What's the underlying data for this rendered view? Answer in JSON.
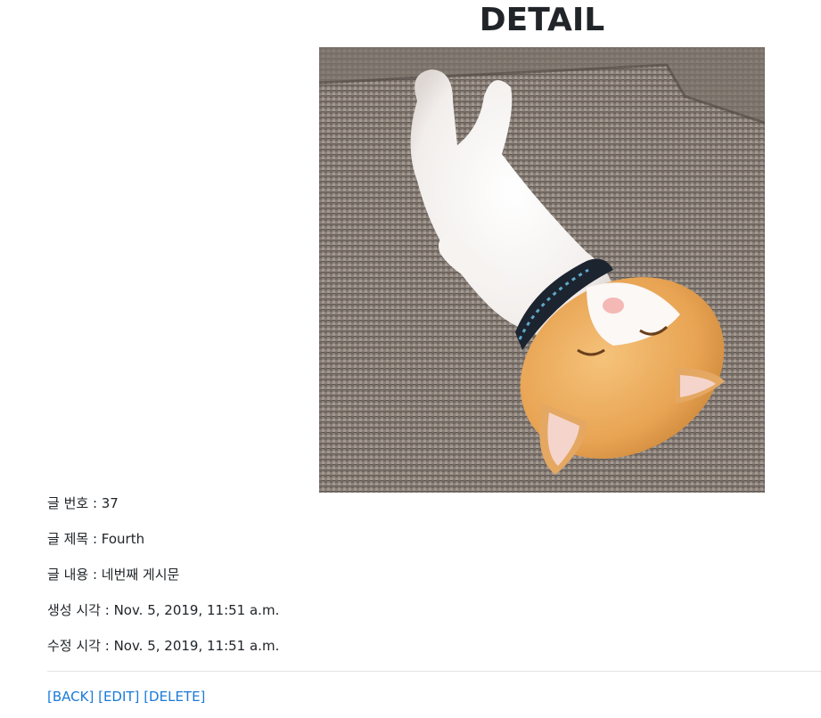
{
  "header": {
    "title": "DETAIL"
  },
  "image": {
    "alt": "cat-sleeping-on-sofa"
  },
  "post": {
    "id_label": "글 번호",
    "id_value": "37",
    "title_label": "글 제목",
    "title_value": "Fourth",
    "content_label": "글 내용",
    "content_value": "네번째 게시문",
    "created_label": "생성 시각",
    "created_value": "Nov. 5, 2019, 11:51 a.m.",
    "updated_label": "수정 시각",
    "updated_value": "Nov. 5, 2019, 11:51 a.m.",
    "separator": " : "
  },
  "actions": {
    "back": "[BACK]",
    "edit": "[EDIT]",
    "delete": "[DELETE]"
  },
  "colors": {
    "link": "#1a7bd8",
    "text": "#212529",
    "divider": "#e1e3e5"
  }
}
